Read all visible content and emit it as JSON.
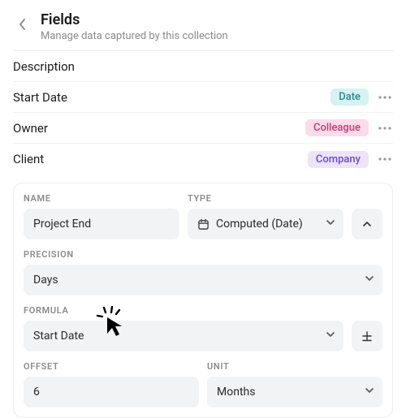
{
  "header": {
    "title": "Fields",
    "subtitle": "Manage data captured by this collection"
  },
  "fields": [
    {
      "label": "Description",
      "badge": null
    },
    {
      "label": "Start Date",
      "badge": "Date",
      "badge_class": "badge-date"
    },
    {
      "label": "Owner",
      "badge": "Colleague",
      "badge_class": "badge-colleague"
    },
    {
      "label": "Client",
      "badge": "Company",
      "badge_class": "badge-company"
    }
  ],
  "editor": {
    "name_label": "NAME",
    "name_value": "Project End",
    "type_label": "TYPE",
    "type_value": "Computed (Date)",
    "precision_label": "PRECISION",
    "precision_value": "Days",
    "formula_label": "FORMULA",
    "formula_value": "Start Date",
    "offset_label": "OFFSET",
    "offset_value": "6",
    "unit_label": "UNIT",
    "unit_value": "Months"
  }
}
